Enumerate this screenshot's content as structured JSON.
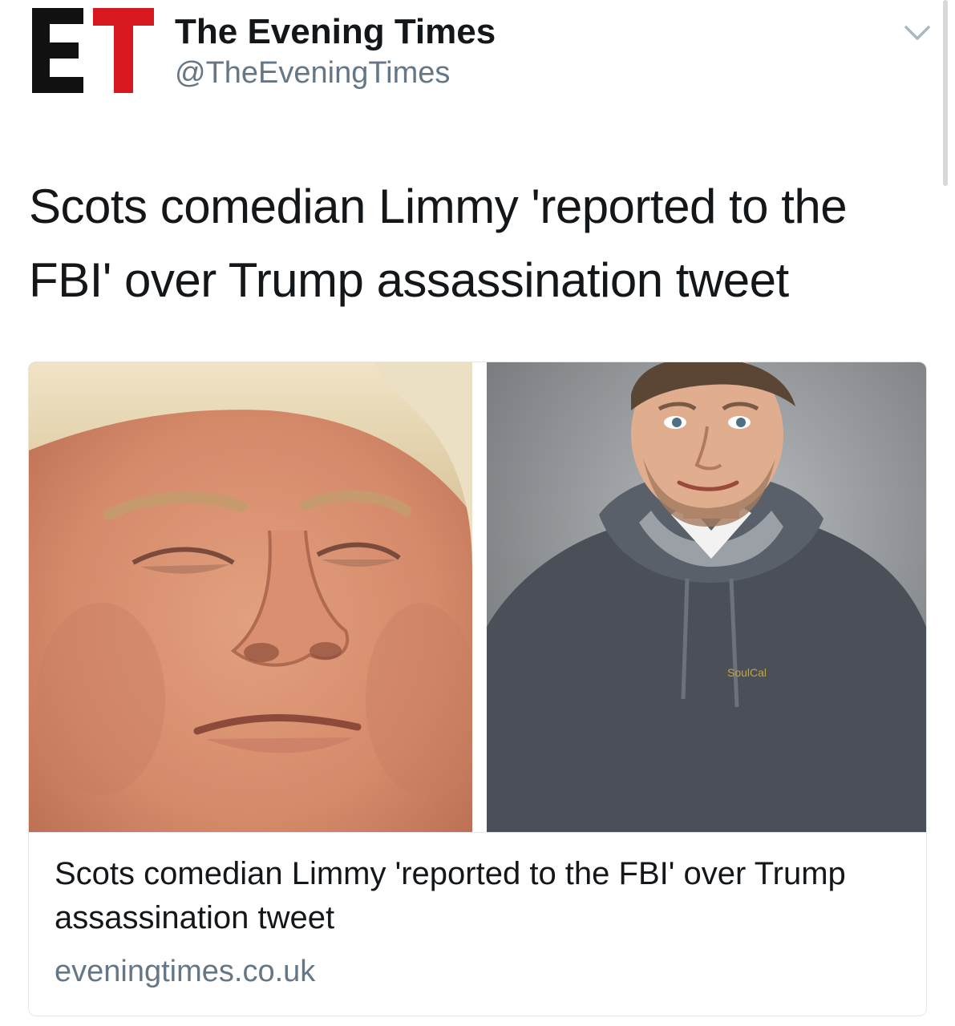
{
  "account": {
    "logo_text": "ET",
    "display_name": "The Evening Times",
    "handle": "@TheEveningTimes"
  },
  "tweet": {
    "text": "Scots comedian Limmy 'reported to the FBI' over Trump assassination tweet"
  },
  "card": {
    "title": "Scots comedian Limmy 'reported to the FBI' over Trump assassination tweet",
    "domain": "eveningtimes.co.uk",
    "hoodie_logo": "SoulCal"
  },
  "colors": {
    "logo_black": "#111111",
    "logo_red": "#d7191f",
    "text_primary": "#14171a",
    "text_secondary": "#657786",
    "border": "#e1e8ed"
  },
  "icons": {
    "caret": "chevron-down-icon"
  }
}
